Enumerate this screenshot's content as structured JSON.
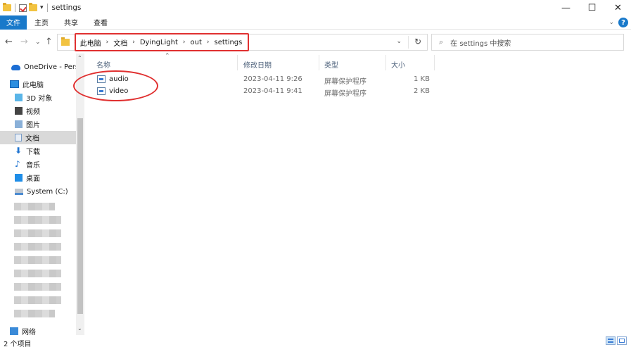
{
  "window": {
    "title": "settings",
    "minimize_glyph": "—",
    "maximize_glyph": "☐",
    "close_glyph": "✕"
  },
  "ribbon": {
    "tabs": [
      {
        "label": "文件"
      },
      {
        "label": "主页"
      },
      {
        "label": "共享"
      },
      {
        "label": "查看"
      }
    ]
  },
  "address": {
    "crumbs": [
      {
        "label": "此电脑"
      },
      {
        "label": "文档"
      },
      {
        "label": "DyingLight"
      },
      {
        "label": "out"
      },
      {
        "label": "settings"
      }
    ]
  },
  "search": {
    "placeholder": "在 settings 中搜索"
  },
  "sidebar": {
    "items": [
      {
        "label": "OneDrive - Perso",
        "icon": "cloud-icon"
      },
      {
        "label": "此电脑",
        "icon": "computer-icon"
      },
      {
        "label": "3D 对象",
        "icon": "cube-icon"
      },
      {
        "label": "视频",
        "icon": "video-icon"
      },
      {
        "label": "图片",
        "icon": "picture-icon"
      },
      {
        "label": "文档",
        "icon": "document-icon",
        "selected": true
      },
      {
        "label": "下载",
        "icon": "download-icon"
      },
      {
        "label": "音乐",
        "icon": "music-icon"
      },
      {
        "label": "桌面",
        "icon": "desktop-icon"
      },
      {
        "label": "System (C:)",
        "icon": "drive-icon"
      },
      {
        "label": "网络",
        "icon": "network-icon"
      }
    ]
  },
  "columns": {
    "name": "名称",
    "date": "修改日期",
    "type": "类型",
    "size": "大小"
  },
  "files": [
    {
      "name": "audio",
      "date": "2023-04-11 9:26",
      "type": "屏幕保护程序",
      "size": "1 KB"
    },
    {
      "name": "video",
      "date": "2023-04-11 9:41",
      "type": "屏幕保护程序",
      "size": "2 KB"
    }
  ],
  "status": {
    "count": "2 个项目"
  },
  "colors": {
    "accent": "#1979ca",
    "annotation": "#e03030",
    "selected_bg": "#d9d9d9"
  }
}
